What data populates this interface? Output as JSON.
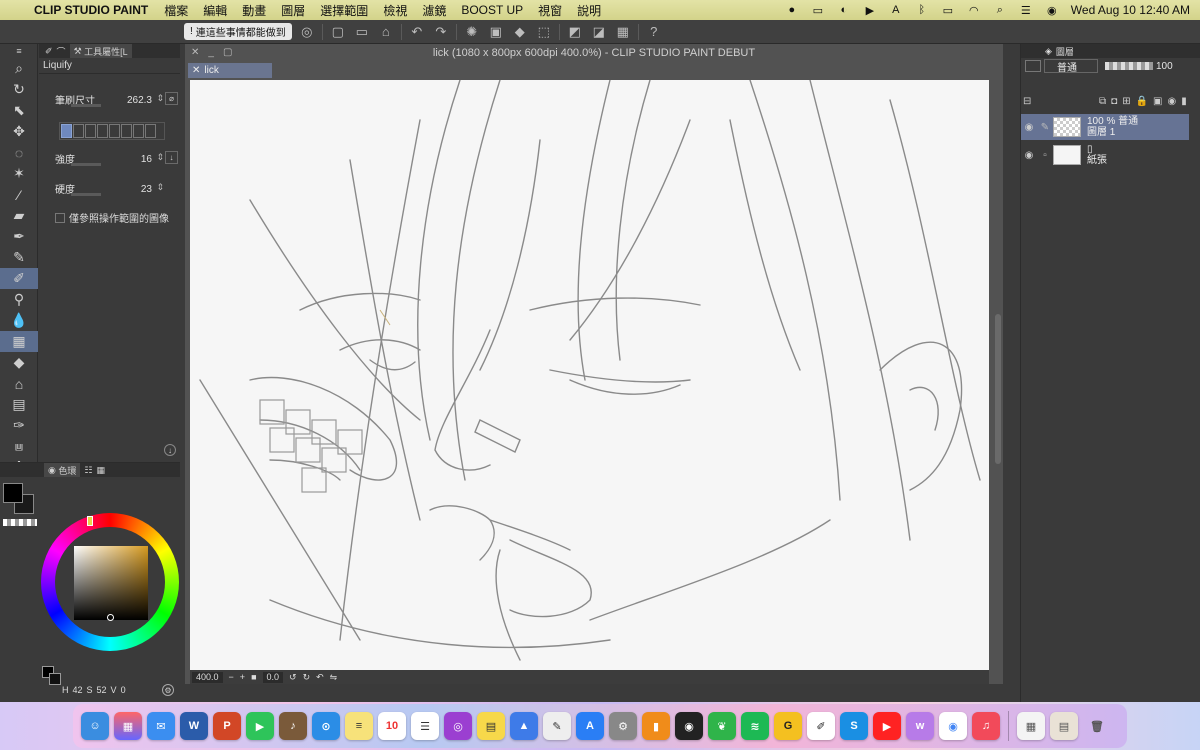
{
  "menubar": {
    "app_name": "CLIP STUDIO PAINT",
    "items": [
      "檔案",
      "編輯",
      "動畫",
      "圖層",
      "選擇範圍",
      "檢視",
      "濾鏡",
      "BOOST UP",
      "視窗",
      "說明"
    ],
    "clock": "Wed Aug 10  12:40 AM"
  },
  "commandbar": {
    "notice_label": "連這些事情都能做到"
  },
  "toolprop": {
    "tab_label": "工具屬性[L",
    "tool_name": "Liquify",
    "brush_size_label": "筆刷尺寸",
    "brush_size_value": "262.3",
    "strength_label": "強度",
    "strength_value": "16",
    "hardness_label": "硬度",
    "hardness_value": "23",
    "ref_checkbox_label": "僅參照操作範圍的圖像"
  },
  "colorpanel": {
    "tab_label": "色環",
    "readout_h": "42",
    "readout_s": "52",
    "readout_v": "0"
  },
  "canvas": {
    "window_title": "lick (1080 x 800px 600dpi 400.0%)  - CLIP STUDIO PAINT DEBUT",
    "doc_tab": "lick",
    "zoom": "400.0",
    "angle": "0.0"
  },
  "layers": {
    "tab_label": "圖層",
    "blend_mode": "普通",
    "opacity": "100",
    "items": [
      {
        "line1": "100 % 普通",
        "line2": "圖層 1"
      },
      {
        "line1": "",
        "line2": "紙張"
      }
    ]
  },
  "colors": {
    "selection": "#667394",
    "active_tool": "#5b6d8e",
    "menubar": "#d9d98a"
  }
}
